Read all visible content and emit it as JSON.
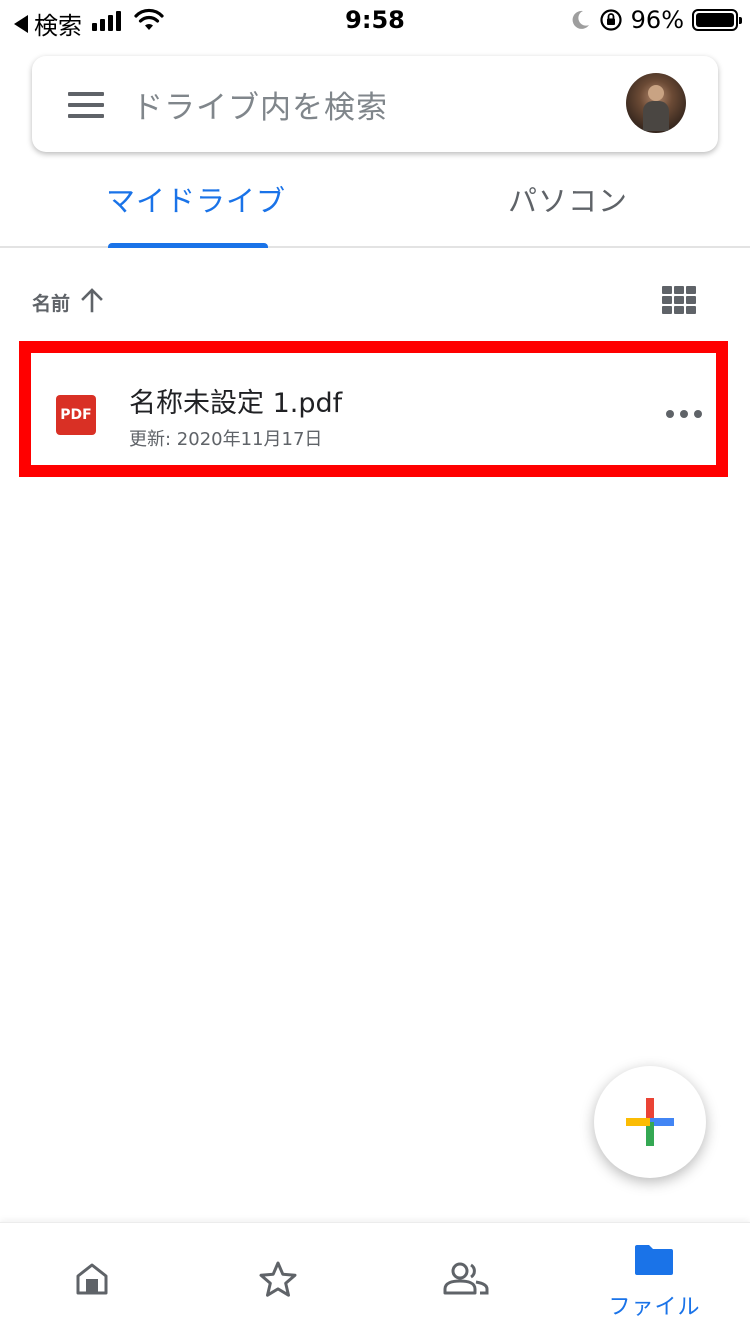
{
  "status_bar": {
    "back_label": "検索",
    "time": "9:58",
    "battery": "96%"
  },
  "search": {
    "placeholder": "ドライブ内を検索"
  },
  "tabs": [
    {
      "label": "マイドライブ",
      "active": true
    },
    {
      "label": "パソコン",
      "active": false
    }
  ],
  "sort": {
    "label": "名前"
  },
  "files": [
    {
      "name": "名称未設定 1.pdf",
      "modified": "更新: 2020年11月17日",
      "icon_text": "PDF",
      "type": "pdf"
    }
  ],
  "bottom_nav": {
    "items": [
      {
        "icon": "home-icon",
        "label": ""
      },
      {
        "icon": "star-icon",
        "label": ""
      },
      {
        "icon": "shared-icon",
        "label": ""
      },
      {
        "icon": "folder-icon",
        "label": "ファイル",
        "active": true
      }
    ]
  },
  "colors": {
    "accent": "#1a73e8",
    "highlight": "#ff0000",
    "pdf": "#d93025",
    "icon_gray": "#5f6368"
  }
}
